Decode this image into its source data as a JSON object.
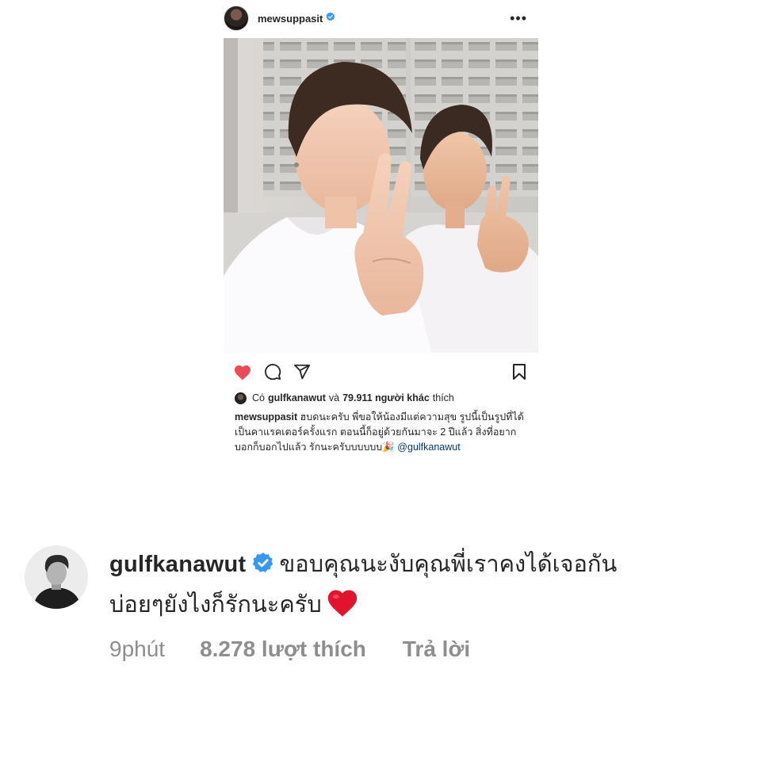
{
  "post": {
    "username": "mewsuppasit",
    "more_icon": "more-dots-icon",
    "photo_alt": "selfie",
    "likes": {
      "prefix": "Có",
      "liker": "gulfkanawut",
      "middle": "và",
      "count": "79.911 người khác",
      "suffix": "thích"
    },
    "caption": {
      "username": "mewsuppasit",
      "text": "ฮบดนะครับ พี่ขอให้น้องมีแต่ความสุข รูปนี้เป็นรูปที่ได้เป็นคาแรคเตอร์ครั้งแรก ตอนนี้ก็อยู่ด้วยกันมาจะ 2 ปีแล้ว สิ่งที่อยากบอกก็บอกไปแล้ว รักนะครับบบบบบ🎉",
      "mention": "@gulfkanawut"
    }
  },
  "comment": {
    "username": "gulfkanawut",
    "text_line1": "ขอบคุณนะงับคุณพี่เราคงได้เจอกัน",
    "text_line2": "บ่อยๆยังไงก็รักนะครับ",
    "time": "9phút",
    "likes": "8.278 lượt thích",
    "reply": "Trả lời"
  },
  "colors": {
    "like_red": "#ed4956",
    "verified_blue": "#3897f0",
    "meta_gray": "#8e8e8e",
    "mention_blue": "#00376b",
    "text": "#262626"
  }
}
